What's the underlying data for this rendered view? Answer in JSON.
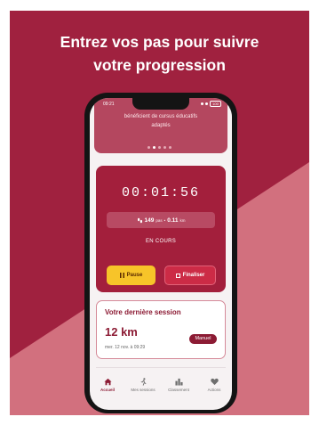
{
  "headline": {
    "line1": "Entrez vos pas pour suivre",
    "line2": "votre progression"
  },
  "colors": {
    "background": "#a0213f",
    "diagonal": "#d2707e",
    "accent_yellow": "#f7c429",
    "finish_red": "#cc2b46"
  },
  "phone": {
    "status_bar": {
      "time": "09:21",
      "battery": "100"
    },
    "banner": {
      "line1": "bénéficient de cursus éducatifs",
      "line2": "adaptés",
      "carousel_total": 5,
      "carousel_active": 1
    },
    "session": {
      "timer": "00:01:56",
      "steps": "149",
      "steps_unit": "pas",
      "separator": "•",
      "distance": "0.11",
      "distance_unit": "km",
      "status": "EN COURS",
      "pause_label": "Pause",
      "pause_icon": "pause-icon",
      "finish_label": "Finaliser",
      "finish_icon": "stop-square-icon"
    },
    "last_session": {
      "title": "Votre dernière session",
      "distance": "12 km",
      "date": "mer. 12 nov. à 09:29",
      "badge": "Manuel"
    },
    "nav": [
      {
        "label": "Accueil",
        "icon": "home-icon",
        "active": true
      },
      {
        "label": "Mes sessions",
        "icon": "runner-icon",
        "active": false
      },
      {
        "label": "Classement",
        "icon": "leaderboard-icon",
        "active": false
      },
      {
        "label": "Actions",
        "icon": "heart-icon",
        "active": false
      }
    ]
  }
}
